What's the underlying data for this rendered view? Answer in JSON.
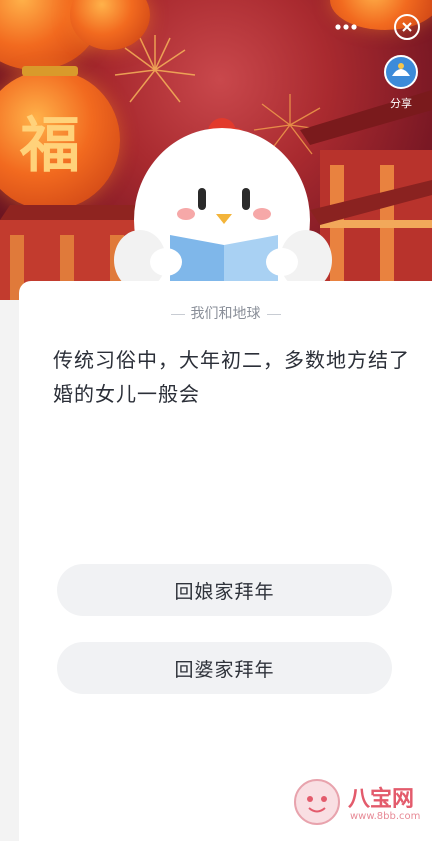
{
  "header": {
    "more_icon": "more-dots-icon",
    "close_icon": "close-circle-icon",
    "share_label": "分享",
    "banner_character": "福"
  },
  "card": {
    "source": "我们和地球",
    "question": "传统习俗中，大年初二，多数地方结了婚的女儿一般会",
    "options": [
      {
        "label": "回娘家拜年"
      },
      {
        "label": "回婆家拜年"
      }
    ]
  },
  "watermark": {
    "text": "八宝网",
    "url": "www.8bb.com"
  },
  "colors": {
    "banner_red": "#a92a2f",
    "lantern_orange": "#f26a1f",
    "card_bg": "#ffffff",
    "option_bg": "#f1f2f4",
    "watermark_pink": "#e35b6c"
  }
}
